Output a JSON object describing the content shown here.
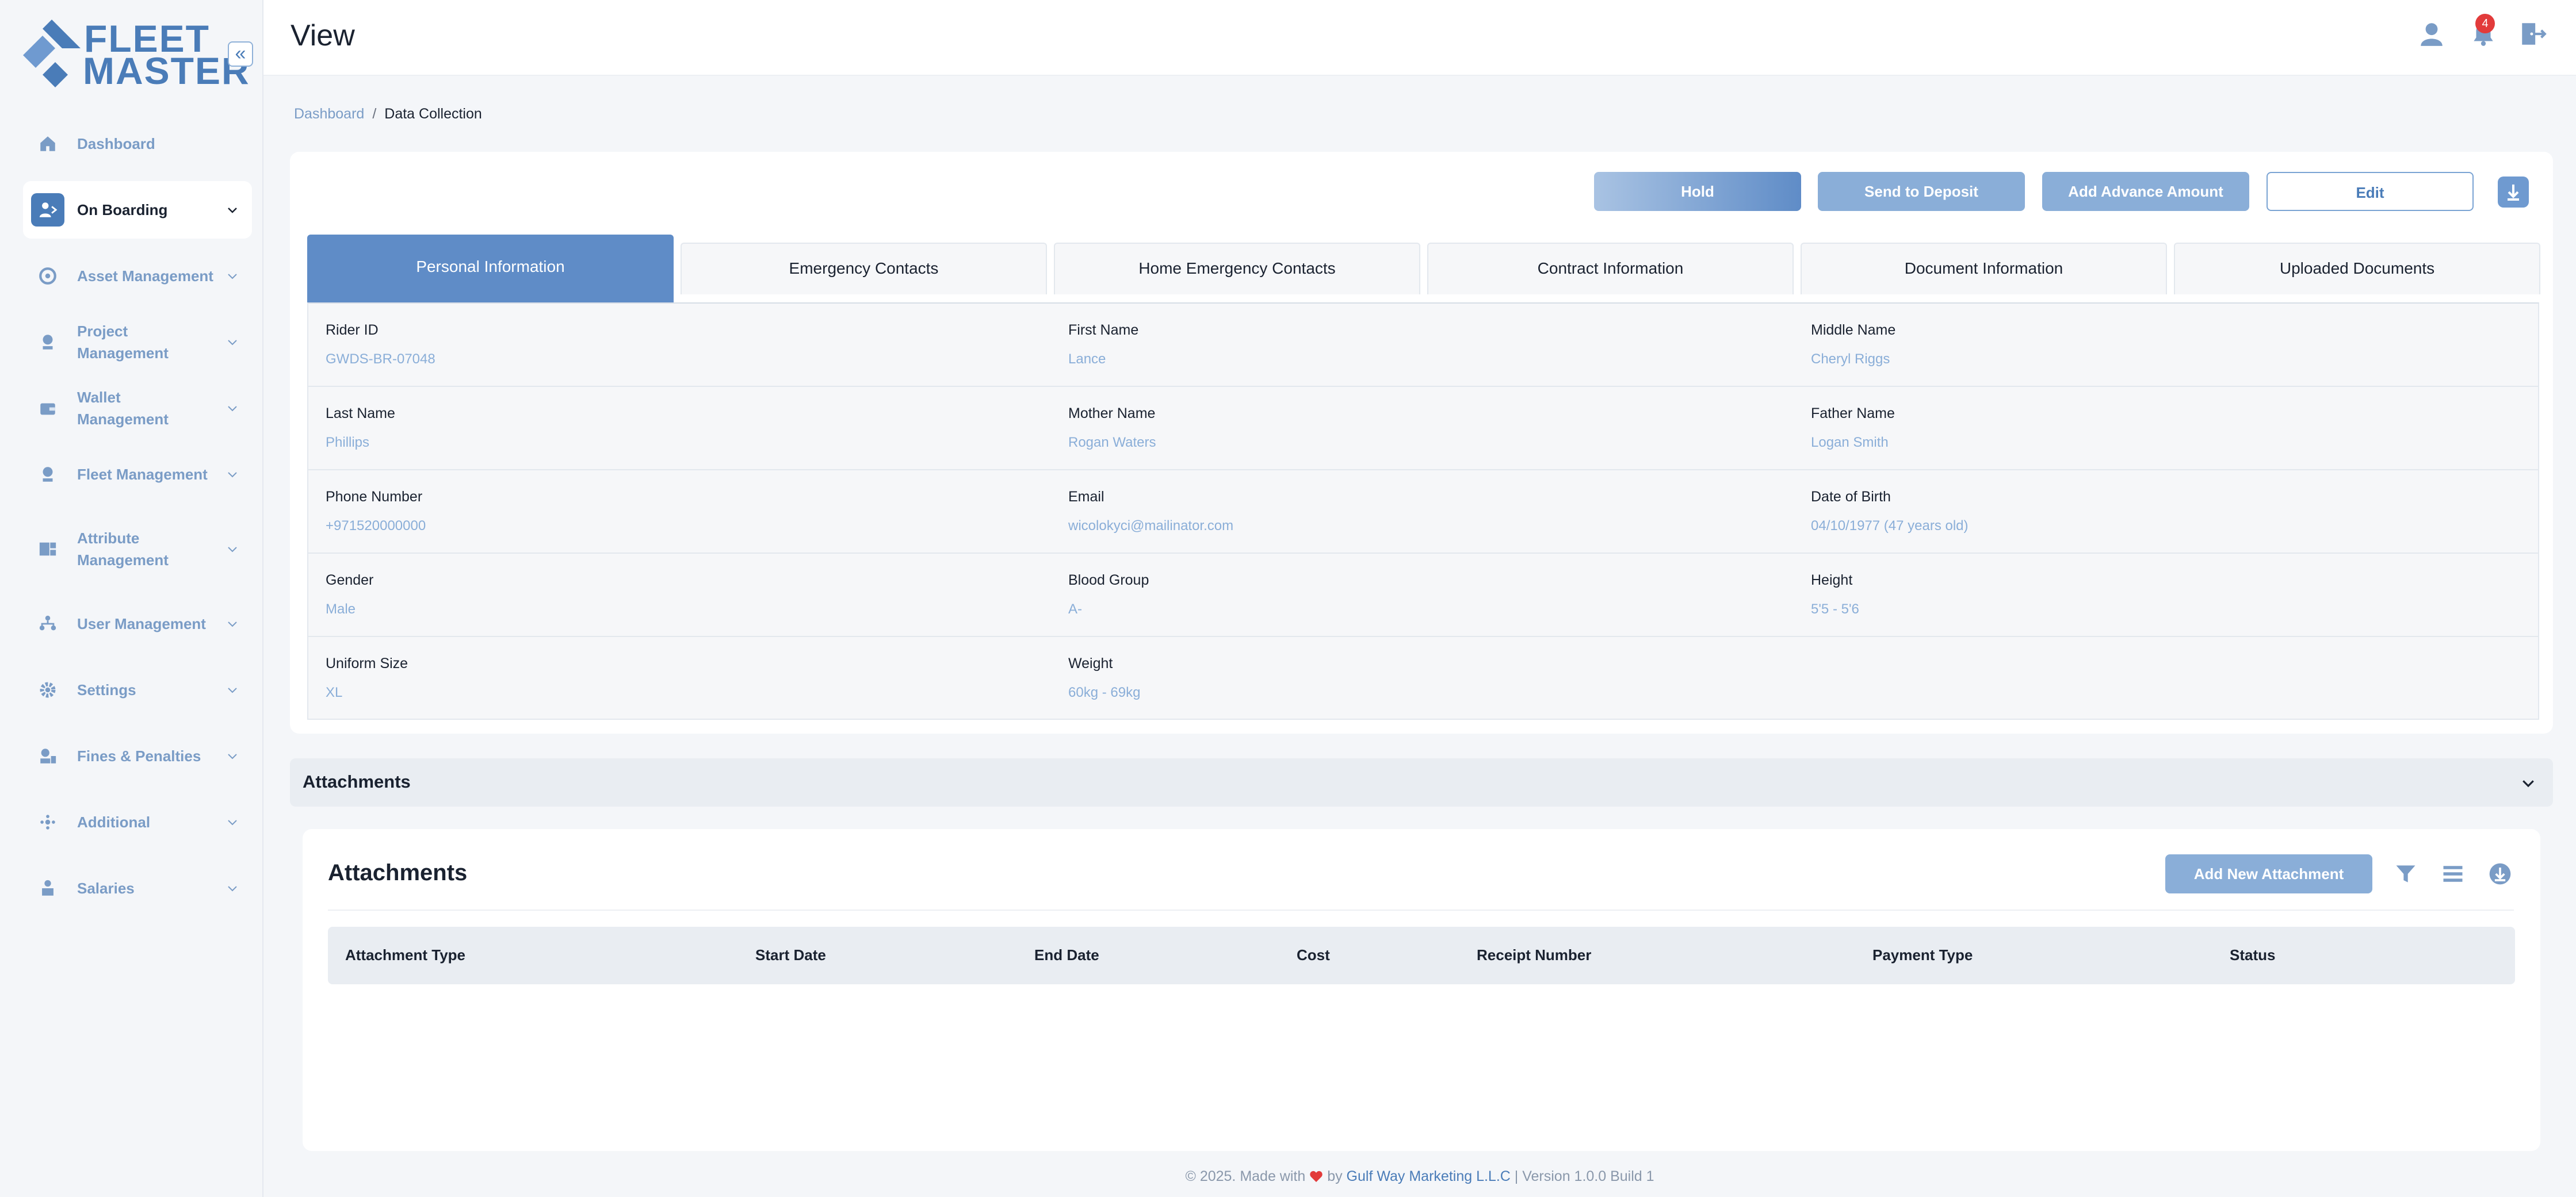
{
  "app": {
    "logo_line1": "FLEET",
    "logo_line2": "MASTER",
    "brand_color": "#4a7cb8"
  },
  "sidebar": {
    "collapse_icon": "double-chevron-left-icon",
    "items": [
      {
        "label": "Dashboard",
        "icon": "home-icon"
      },
      {
        "label": "On Boarding",
        "icon": "onboarding-icon",
        "active": true
      },
      {
        "label": "Asset Management",
        "icon": "asset-icon"
      },
      {
        "label": "Project Management",
        "icon": "project-icon"
      },
      {
        "label": "Wallet Management",
        "icon": "wallet-icon"
      },
      {
        "label": "Fleet Management",
        "icon": "fleet-icon"
      },
      {
        "label": "Attribute Management",
        "icon": "attribute-icon"
      },
      {
        "label": "User Management",
        "icon": "users-icon"
      },
      {
        "label": "Settings",
        "icon": "gear-icon"
      },
      {
        "label": "Fines & Penalties",
        "icon": "fines-icon"
      },
      {
        "label": "Additional",
        "icon": "additional-icon"
      },
      {
        "label": "Salaries",
        "icon": "salaries-icon"
      }
    ]
  },
  "header": {
    "title": "View",
    "notification_count": "4"
  },
  "breadcrumb": {
    "root": "Dashboard",
    "separator": "/",
    "current": "Data Collection"
  },
  "actions": {
    "hold": "Hold",
    "send_to_deposit": "Send to Deposit",
    "add_advance": "Add Advance Amount",
    "edit": "Edit"
  },
  "tabs": [
    "Personal Information",
    "Emergency Contacts",
    "Home Emergency Contacts",
    "Contract Information",
    "Document Information",
    "Uploaded Documents"
  ],
  "personal": {
    "rider_id": {
      "label": "Rider ID",
      "value": "GWDS-BR-07048"
    },
    "first_name": {
      "label": "First Name",
      "value": "Lance"
    },
    "middle_name": {
      "label": "Middle Name",
      "value": "Cheryl Riggs"
    },
    "last_name": {
      "label": "Last Name",
      "value": "Phillips"
    },
    "mother_name": {
      "label": "Mother Name",
      "value": "Rogan Waters"
    },
    "father_name": {
      "label": "Father Name",
      "value": "Logan Smith"
    },
    "phone": {
      "label": "Phone Number",
      "value": "+971520000000"
    },
    "email": {
      "label": "Email",
      "value": "wicolokyci@mailinator.com"
    },
    "dob": {
      "label": "Date of Birth",
      "value": "04/10/1977 (47 years old)"
    },
    "gender": {
      "label": "Gender",
      "value": "Male"
    },
    "blood_group": {
      "label": "Blood Group",
      "value": "A-"
    },
    "height": {
      "label": "Height",
      "value": "5'5 - 5'6"
    },
    "uniform": {
      "label": "Uniform Size",
      "value": "XL"
    },
    "weight": {
      "label": "Weight",
      "value": "60kg - 69kg"
    }
  },
  "attachments": {
    "accordion_title": "Attachments",
    "title": "Attachments",
    "add_button": "Add New Attachment",
    "columns": [
      "Attachment Type",
      "Start Date",
      "End Date",
      "Cost",
      "Receipt Number",
      "Payment Type",
      "Status"
    ]
  },
  "footer": {
    "prefix": "© 2025. Made with",
    "by": "by",
    "company": "Gulf Way Marketing L.L.C",
    "version": "| Version 1.0.0 Build 1"
  }
}
